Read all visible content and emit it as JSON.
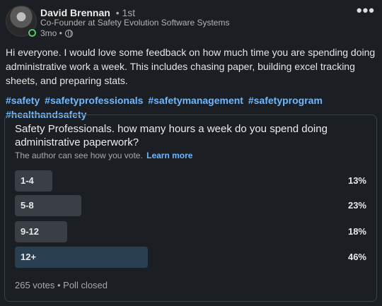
{
  "author": {
    "name": "David Brennan",
    "degree": "• 1st",
    "headline": "Co-Founder at Safety Evolution Software Systems",
    "time": "3mo •"
  },
  "menu_icon": "more-horizontal-icon",
  "post": {
    "text": "Hi everyone. I would love some feedback on how much time you are spending doing administrative work a week. This includes chasing paper, building excel tracking sheets, and preparing stats.",
    "hashtags": [
      "#safety",
      "#safetyprofessionals",
      "#safetymanagement",
      "#safetyprogram",
      "#healthandsafety"
    ]
  },
  "poll": {
    "question": "Safety Professionals. how many hours a week do you spend doing administrative paperwork?",
    "note": "The author can see how you vote.",
    "learn_more": "Learn more",
    "options": [
      {
        "label": "1-4",
        "pct_text": "13%",
        "fraction": 0.13
      },
      {
        "label": "5-8",
        "pct_text": "23%",
        "fraction": 0.23
      },
      {
        "label": "9-12",
        "pct_text": "18%",
        "fraction": 0.18
      },
      {
        "label": "12+",
        "pct_text": "46%",
        "fraction": 0.46
      }
    ],
    "footer": "265 votes • Poll closed"
  },
  "colors": {
    "accent": "#71b7fb",
    "background": "#1b1f23",
    "online": "#5fbf6a"
  }
}
